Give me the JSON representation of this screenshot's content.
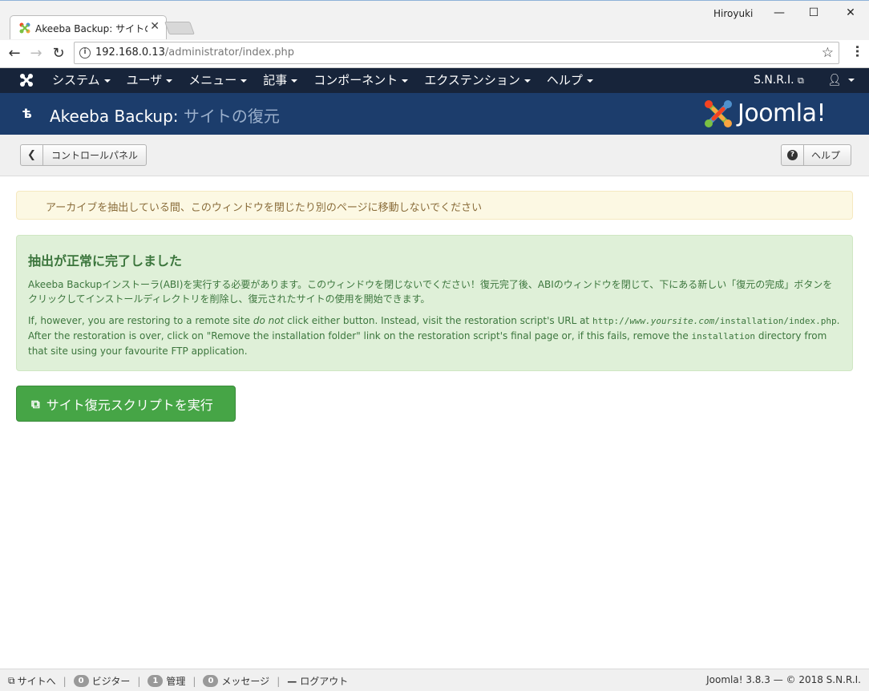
{
  "browser": {
    "tab_title": "Akeeba Backup: サイトの復",
    "tab_close": "✕",
    "profile_name": "Hiroyuki",
    "url_host": "192.168.0.13",
    "url_path": "/administrator/index.php",
    "back_icon": "back-arrow-icon",
    "forward_icon": "forward-arrow-icon",
    "reload_icon": "reload-icon"
  },
  "navbar": {
    "items": [
      {
        "label": "システム"
      },
      {
        "label": "ユーザ"
      },
      {
        "label": "メニュー"
      },
      {
        "label": "記事"
      },
      {
        "label": "コンポーネント"
      },
      {
        "label": "エクステンション"
      },
      {
        "label": "ヘルプ"
      }
    ],
    "site_name": "S.N.R.I.",
    "bg_color": "#17243a"
  },
  "titlebar": {
    "title": "Akeeba Backup:",
    "subtitle": "サイトの復元",
    "brand": "Joomla!",
    "bg_color": "#1c3d6c"
  },
  "toolbar": {
    "back_label": "コントロールパネル",
    "help_label": "ヘルプ"
  },
  "warning": {
    "text": "アーカイブを抽出している間、このウィンドウを閉じたり別のページに移動しないでください"
  },
  "success": {
    "title": "抽出が正常に完了しました",
    "p1": "Akeeba Backupインストーラ(ABI)を実行する必要があります。このウィンドウを閉じないでください！復元完了後、ABIのウィンドウを閉じて、下にある新しい「復元の完成」ボタンをクリックしてインストールディレクトリを削除し、復元されたサイトの使用を開始できます。",
    "p2_a": "If, however, you are restoring to a remote site ",
    "p2_em": "do not",
    "p2_b": " click either button. Instead, visit the restoration script's URL at ",
    "p2_url1": "http://",
    "p2_url2": "www.yoursite.com",
    "p2_url3": "/installation/index.php",
    "p2_c": ". After the restoration is over, click on \"Remove the installation folder\" link on the restoration script's final page or, if this fails, remove the ",
    "p2_dir": "installation",
    "p2_d": " directory from that site using your favourite FTP application."
  },
  "run_button": {
    "label": "サイト復元スクリプトを実行",
    "color": "#46a546"
  },
  "statusbar": {
    "view_site": "サイトへ",
    "visitors_count": "0",
    "visitors_label": "ビジター",
    "admins_count": "1",
    "admins_label": "管理",
    "messages_count": "0",
    "messages_label": "メッセージ",
    "logout_label": "ログアウト",
    "version": "Joomla! 3.8.3",
    "copyright": "— © 2018 S.N.R.I."
  }
}
